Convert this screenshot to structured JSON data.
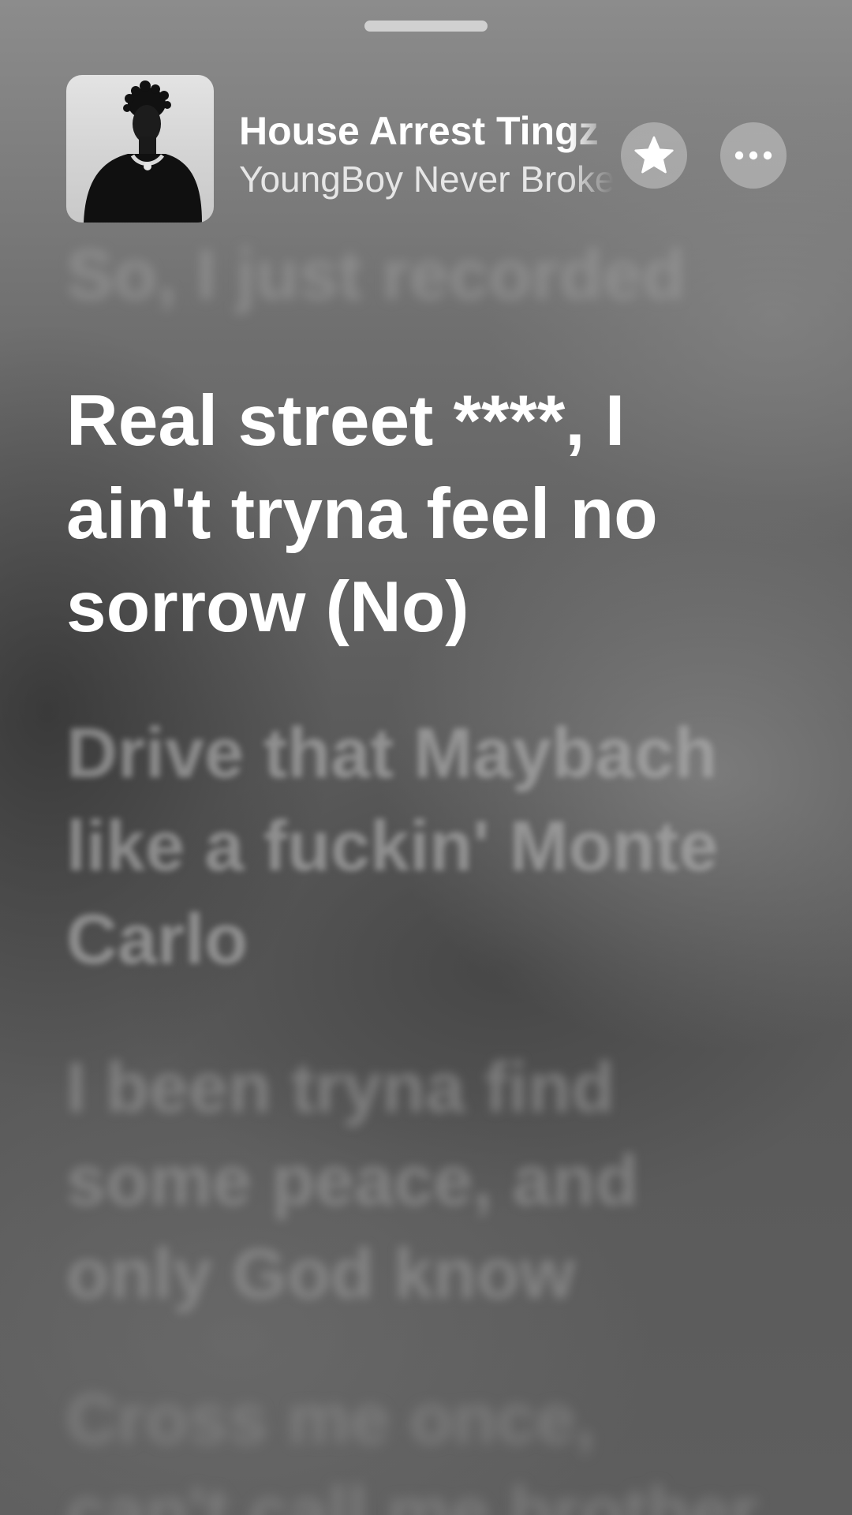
{
  "now_playing": {
    "title": "House Arrest Tingz",
    "artist": "YoungBoy Never Broke Again",
    "artwork_icon": "album-artwork-portrait"
  },
  "controls": {
    "star_icon": "star-icon",
    "more_icon": "ellipsis-icon"
  },
  "lyrics": {
    "previous": "So, I just recorded",
    "current": "Real street ****, I ain't tryna feel no sorrow (No)",
    "next": [
      "Drive that Maybach like a fuckin' Monte Carlo",
      "I been tryna find some peace, and only God know",
      "Cross me once, can't call me brother"
    ]
  },
  "colors": {
    "active_lyric": "#ffffff",
    "inactive_lyric": "#a0a0a0",
    "button_fill": "#e1e1e1"
  }
}
